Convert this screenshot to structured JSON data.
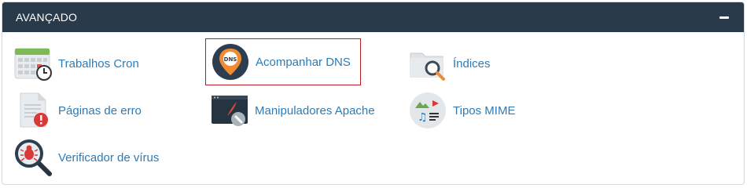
{
  "panel": {
    "title": "AVANÇADO",
    "collapse_icon": "minus-icon"
  },
  "items": [
    {
      "label": "Trabalhos Cron",
      "icon": "cron-calendar-icon"
    },
    {
      "label": "Acompanhar DNS",
      "icon": "dns-pin-icon",
      "selected": true
    },
    {
      "label": "Índices",
      "icon": "folder-search-icon"
    },
    {
      "label": "Páginas de erro",
      "icon": "error-page-icon"
    },
    {
      "label": "Manipuladores Apache",
      "icon": "apache-handler-icon"
    },
    {
      "label": "Tipos MIME",
      "icon": "mime-types-icon"
    },
    {
      "label": "Verificador de vírus",
      "icon": "virus-scanner-icon"
    }
  ],
  "colors": {
    "header_bg": "#293a4a",
    "link": "#2d7bb5",
    "selected_border": "#b91d24"
  }
}
